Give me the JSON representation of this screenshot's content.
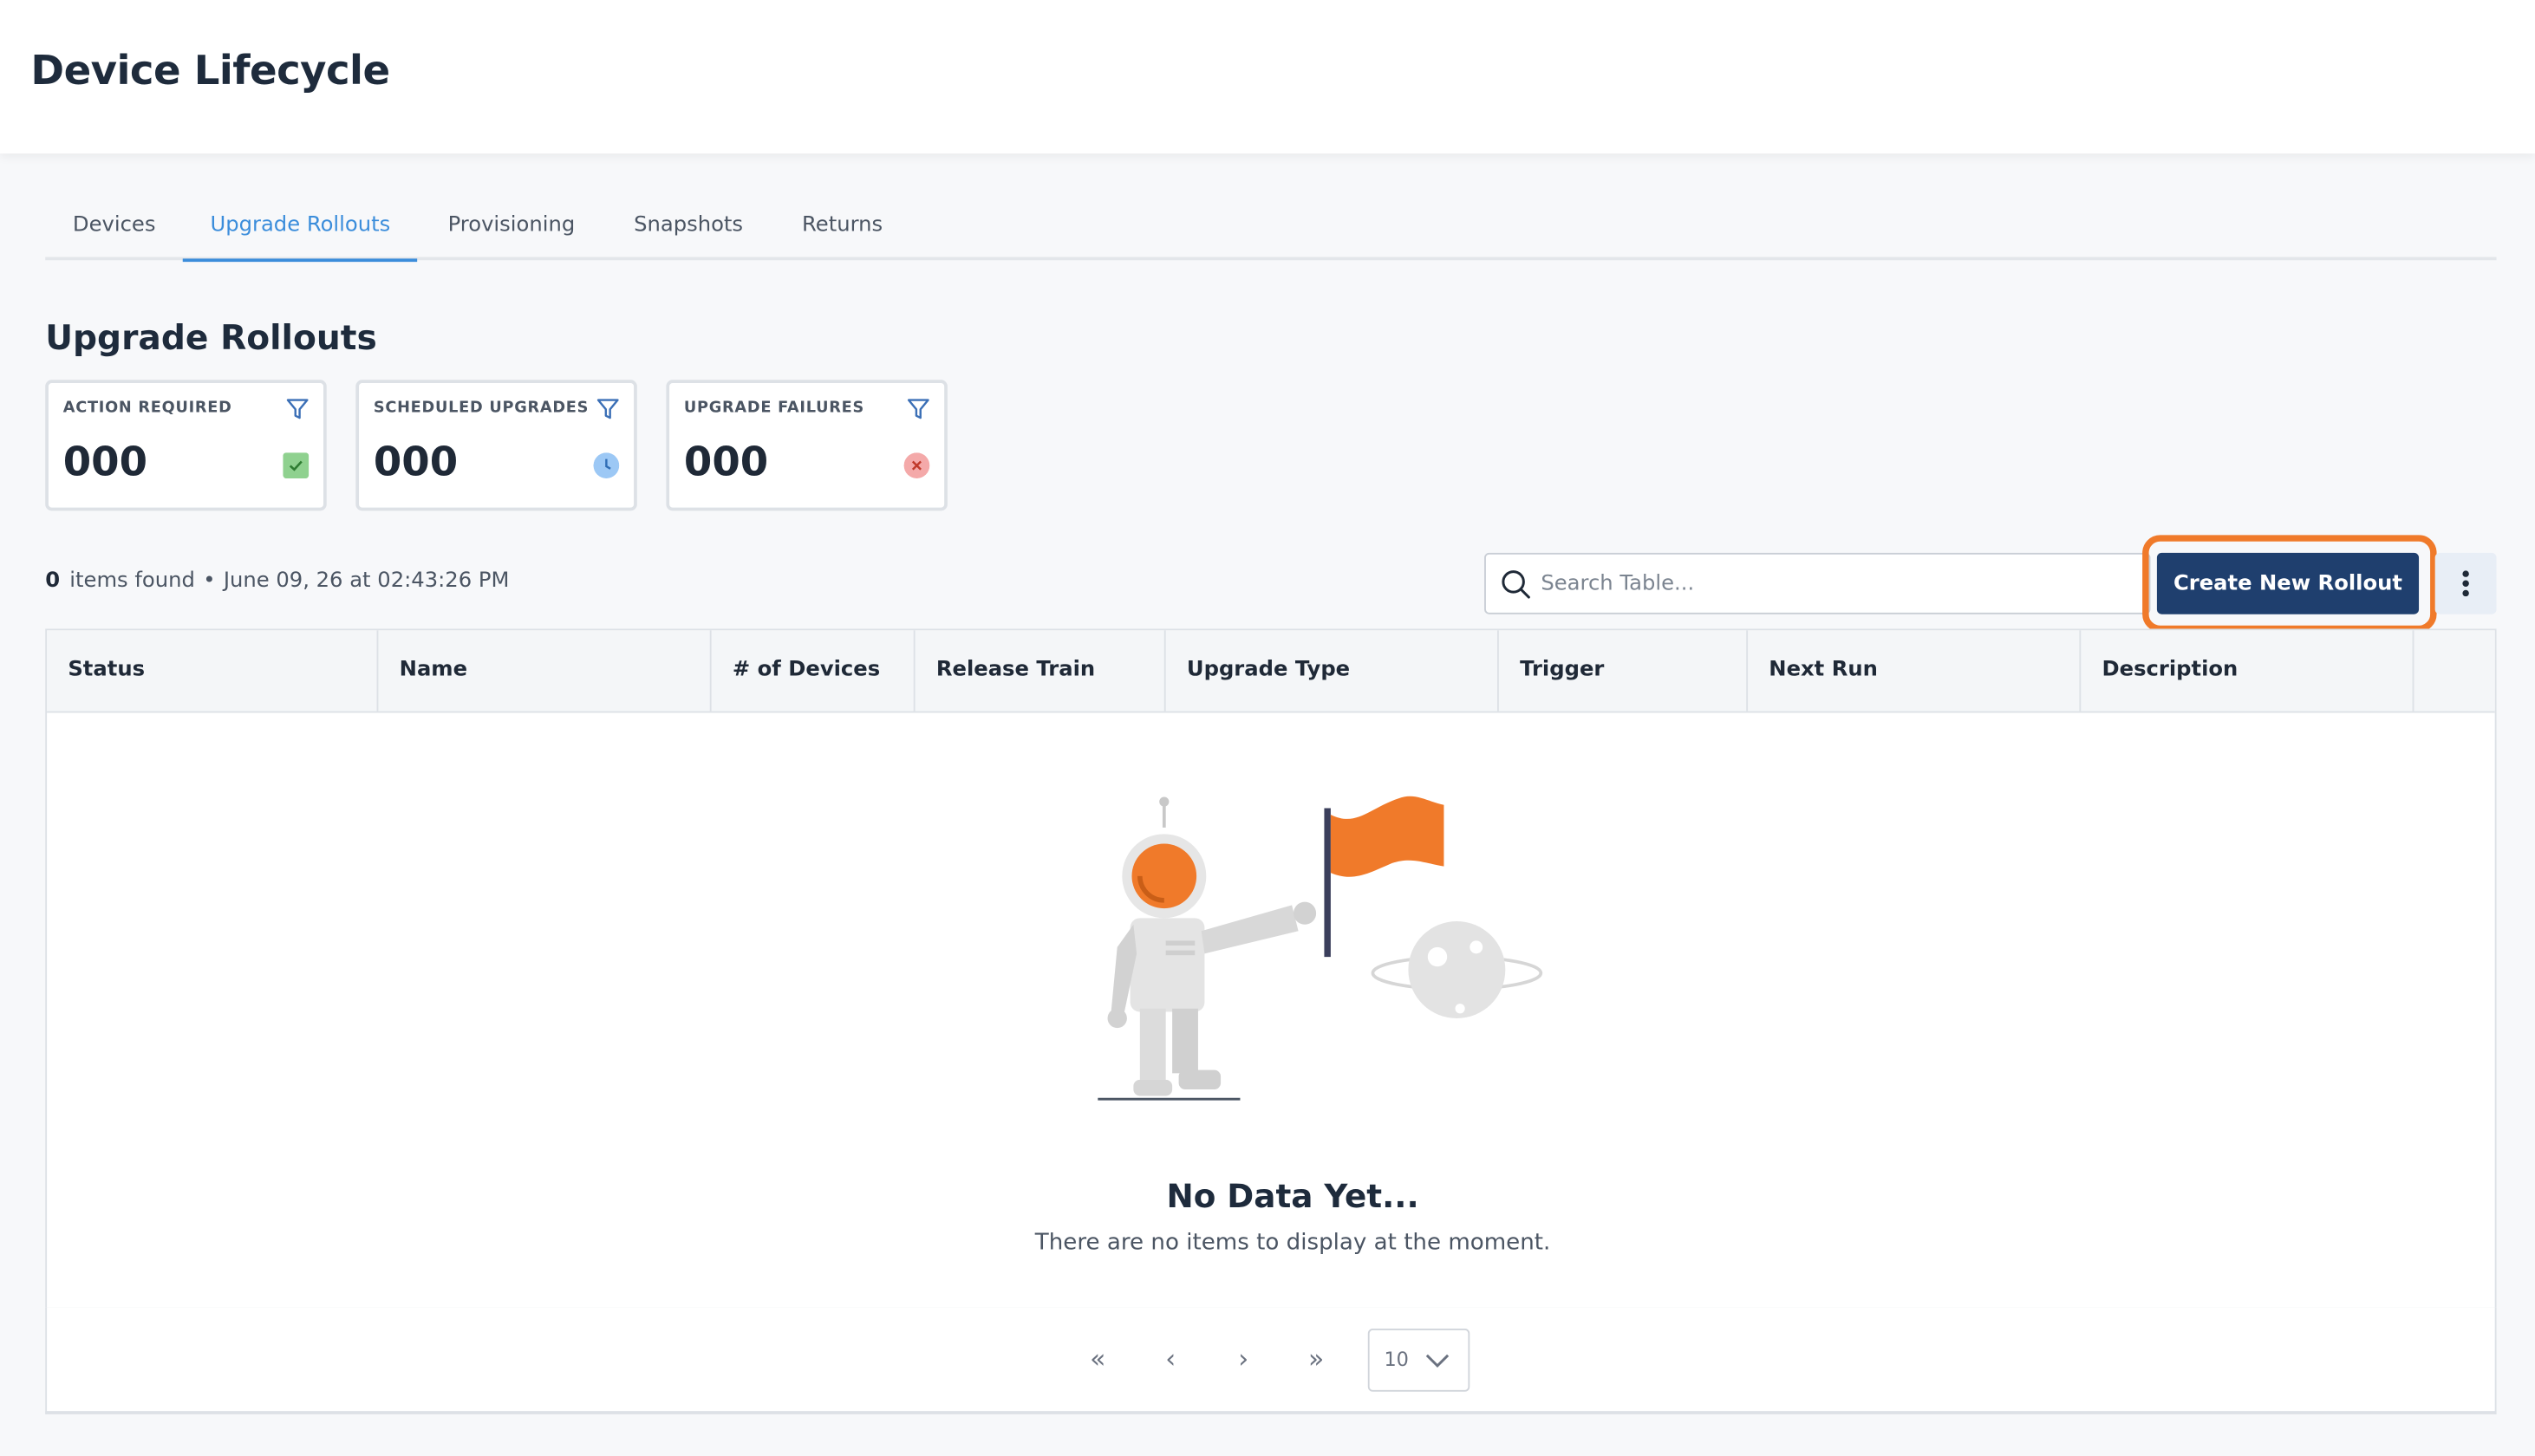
{
  "header": {
    "title": "Device Lifecycle"
  },
  "tabs": [
    {
      "label": "Devices",
      "active": false
    },
    {
      "label": "Upgrade Rollouts",
      "active": true
    },
    {
      "label": "Provisioning",
      "active": false
    },
    {
      "label": "Snapshots",
      "active": false
    },
    {
      "label": "Returns",
      "active": false
    }
  ],
  "section": {
    "title": "Upgrade Rollouts"
  },
  "cards": [
    {
      "label": "ACTION REQUIRED",
      "value": "000",
      "icon": "check-icon",
      "status_color": "#8fd18f"
    },
    {
      "label": "SCHEDULED UPGRADES",
      "value": "000",
      "icon": "clock-icon",
      "status_color": "#9cc8f5"
    },
    {
      "label": "UPGRADE FAILURES",
      "value": "000",
      "icon": "x-icon",
      "status_color": "#f4a9a9"
    }
  ],
  "summary": {
    "count": "0",
    "text": "items found",
    "separator": "•",
    "timestamp": "June 09, 26 at 02:43:26 PM"
  },
  "search": {
    "placeholder": "Search Table..."
  },
  "actions": {
    "create_label": "Create New Rollout"
  },
  "table": {
    "columns": [
      "Status",
      "Name",
      "# of Devices",
      "Release Train",
      "Upgrade Type",
      "Trigger",
      "Next Run",
      "Description"
    ],
    "rows": []
  },
  "empty": {
    "title": "No Data Yet...",
    "subtitle": "There are no items to display at the moment."
  },
  "pagination": {
    "first": "«",
    "prev": "‹",
    "next": "›",
    "last": "»",
    "page_size": "10"
  },
  "colors": {
    "accent": "#3b8ddb",
    "primary_button": "#1f3f6e",
    "highlight": "#f07a2a",
    "flag": "#f07a2a"
  }
}
